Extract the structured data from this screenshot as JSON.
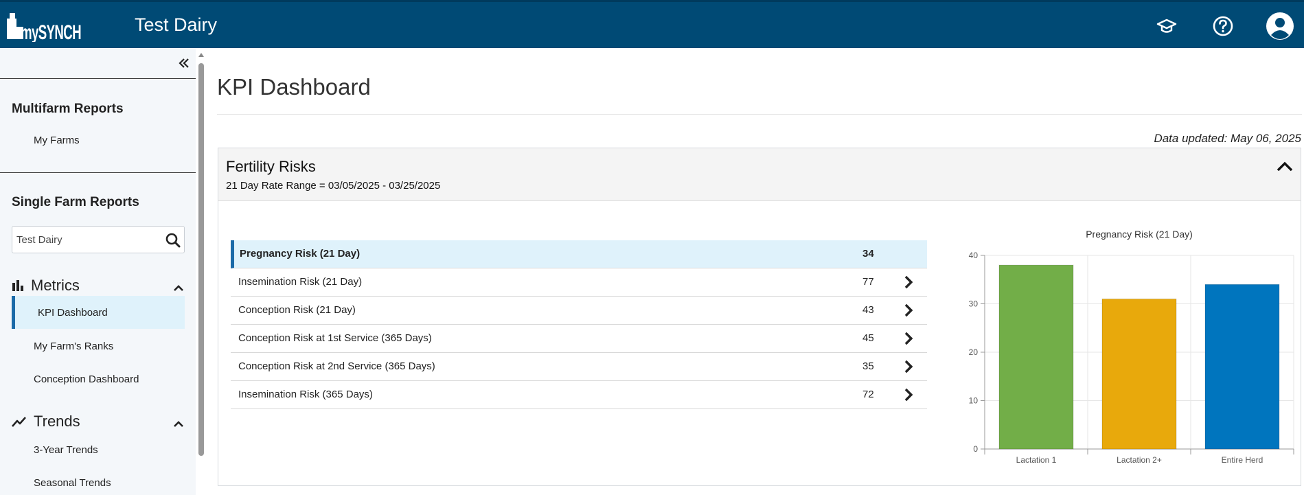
{
  "header": {
    "logo_text": "mySYNCH",
    "farm_name": "Test Dairy",
    "icons": [
      "graduation-cap-icon",
      "help-icon",
      "user-icon"
    ]
  },
  "sidebar": {
    "multifarm": {
      "title": "Multifarm Reports",
      "items": [
        {
          "label": "My Farms"
        }
      ]
    },
    "single": {
      "title": "Single Farm Reports",
      "search": {
        "value": "Test Dairy",
        "placeholder": ""
      }
    },
    "metrics": {
      "label": "Metrics",
      "items": [
        {
          "label": "KPI Dashboard",
          "active": true
        },
        {
          "label": "My Farm's Ranks"
        },
        {
          "label": "Conception Dashboard"
        }
      ]
    },
    "trends": {
      "label": "Trends",
      "items": [
        {
          "label": "3-Year Trends"
        },
        {
          "label": "Seasonal Trends"
        }
      ]
    }
  },
  "main": {
    "title": "KPI Dashboard",
    "updated": "Data updated: May 06, 2025",
    "panel": {
      "title": "Fertility Risks",
      "subtitle": "21 Day Rate Range = 03/05/2025 - 03/25/2025",
      "rows": [
        {
          "label": "Pregnancy Risk (21 Day)",
          "value": "34",
          "selected": true
        },
        {
          "label": "Insemination Risk (21 Day)",
          "value": "77"
        },
        {
          "label": "Conception Risk (21 Day)",
          "value": "43"
        },
        {
          "label": "Conception Risk at 1st Service (365 Days)",
          "value": "45"
        },
        {
          "label": "Conception Risk at 2nd Service (365 Days)",
          "value": "35"
        },
        {
          "label": "Insemination Risk (365 Days)",
          "value": "72"
        }
      ]
    }
  },
  "colors": {
    "header": "#004a75",
    "accent": "#1a6aa8",
    "selected_bg": "#dff2fb"
  },
  "chart_data": {
    "type": "bar",
    "title": "Pregnancy Risk (21 Day)",
    "categories": [
      "Lactation 1",
      "Lactation 2+",
      "Entire Herd"
    ],
    "values": [
      38,
      31,
      34
    ],
    "colors": [
      "#72ae48",
      "#e8a90c",
      "#0075be"
    ],
    "ylim": [
      0,
      40
    ],
    "yticks": [
      0,
      10,
      20,
      30,
      40
    ],
    "grid": true,
    "xlabel": "",
    "ylabel": ""
  }
}
